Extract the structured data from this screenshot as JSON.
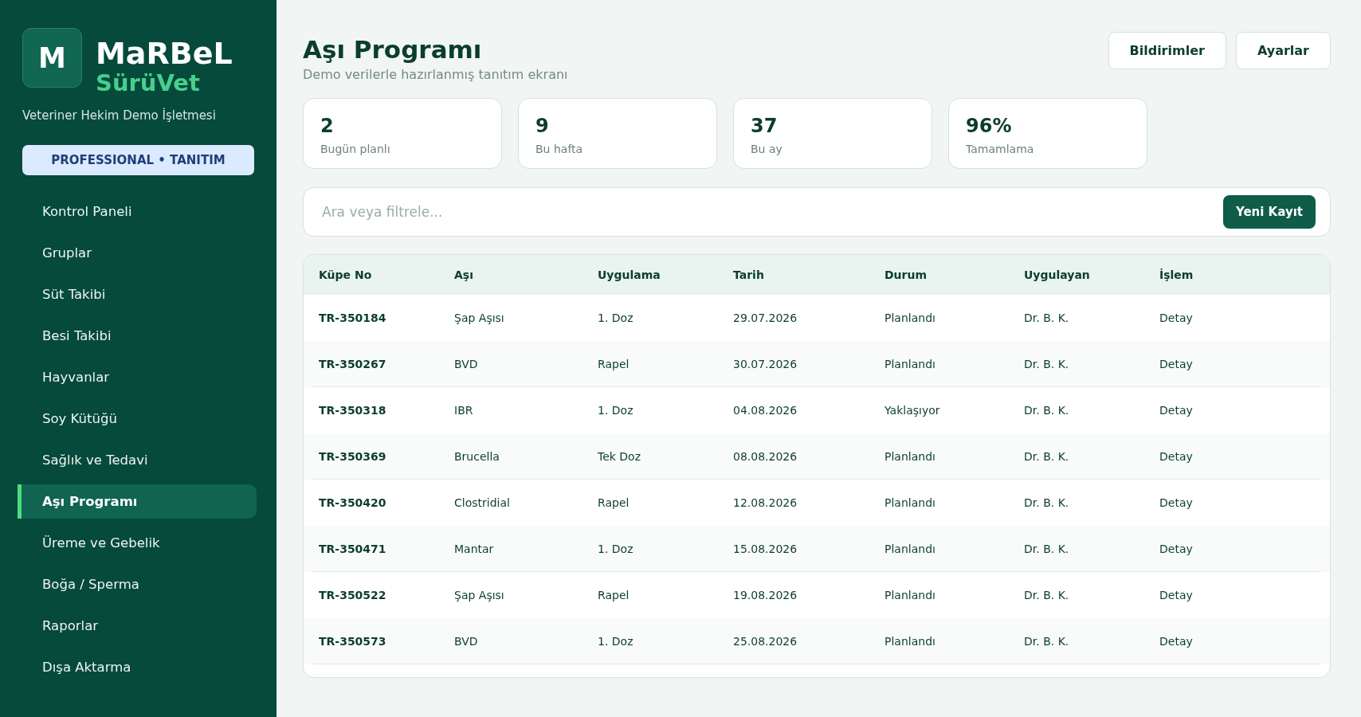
{
  "sidebar": {
    "logo": "M",
    "brand": "MaRBeL",
    "product": "SürüVet",
    "business": "Veteriner Hekim Demo İşletmesi",
    "plan": "PROFESSIONAL • TANITIM",
    "nav": [
      {
        "label": "Kontrol Paneli",
        "selected": false
      },
      {
        "label": "Gruplar",
        "selected": false
      },
      {
        "label": "Süt Takibi",
        "selected": false
      },
      {
        "label": "Besi Takibi",
        "selected": false
      },
      {
        "label": "Hayvanlar",
        "selected": false
      },
      {
        "label": "Soy Kütüğü",
        "selected": false
      },
      {
        "label": "Sağlık ve Tedavi",
        "selected": false
      },
      {
        "label": "Aşı Programı",
        "selected": true
      },
      {
        "label": "Üreme ve Gebelik",
        "selected": false
      },
      {
        "label": "Boğa / Sperma",
        "selected": false
      },
      {
        "label": "Raporlar",
        "selected": false
      },
      {
        "label": "Dışa Aktarma",
        "selected": false
      }
    ]
  },
  "header": {
    "title": "Aşı Programı",
    "subtitle": "Demo verilerle hazırlanmış tanıtım ekranı",
    "buttons": [
      "Bildirimler",
      "Ayarlar"
    ]
  },
  "stats": [
    {
      "value": "2",
      "label": "Bugün planlı"
    },
    {
      "value": "9",
      "label": "Bu hafta"
    },
    {
      "value": "37",
      "label": "Bu ay"
    },
    {
      "value": "96%",
      "label": "Tamamlama"
    }
  ],
  "search": {
    "placeholder": "Ara veya filtrele...",
    "button": "Yeni Kayıt"
  },
  "table": {
    "columns": [
      "Küpe No",
      "Aşı",
      "Uygulama",
      "Tarih",
      "Durum",
      "Uygulayan",
      "İşlem"
    ],
    "rows": [
      [
        "TR-350184",
        "Şap Aşısı",
        "1. Doz",
        "29.07.2026",
        "Planlandı",
        "Dr. B. K.",
        "Detay"
      ],
      [
        "TR-350267",
        "BVD",
        "Rapel",
        "30.07.2026",
        "Planlandı",
        "Dr. B. K.",
        "Detay"
      ],
      [
        "TR-350318",
        "IBR",
        "1. Doz",
        "04.08.2026",
        "Yaklaşıyor",
        "Dr. B. K.",
        "Detay"
      ],
      [
        "TR-350369",
        "Brucella",
        "Tek Doz",
        "08.08.2026",
        "Planlandı",
        "Dr. B. K.",
        "Detay"
      ],
      [
        "TR-350420",
        "Clostridial",
        "Rapel",
        "12.08.2026",
        "Planlandı",
        "Dr. B. K.",
        "Detay"
      ],
      [
        "TR-350471",
        "Mantar",
        "1. Doz",
        "15.08.2026",
        "Planlandı",
        "Dr. B. K.",
        "Detay"
      ],
      [
        "TR-350522",
        "Şap Aşısı",
        "Rapel",
        "19.08.2026",
        "Planlandı",
        "Dr. B. K.",
        "Detay"
      ],
      [
        "TR-350573",
        "BVD",
        "1. Doz",
        "25.08.2026",
        "Planlandı",
        "Dr. B. K.",
        "Detay"
      ]
    ]
  }
}
